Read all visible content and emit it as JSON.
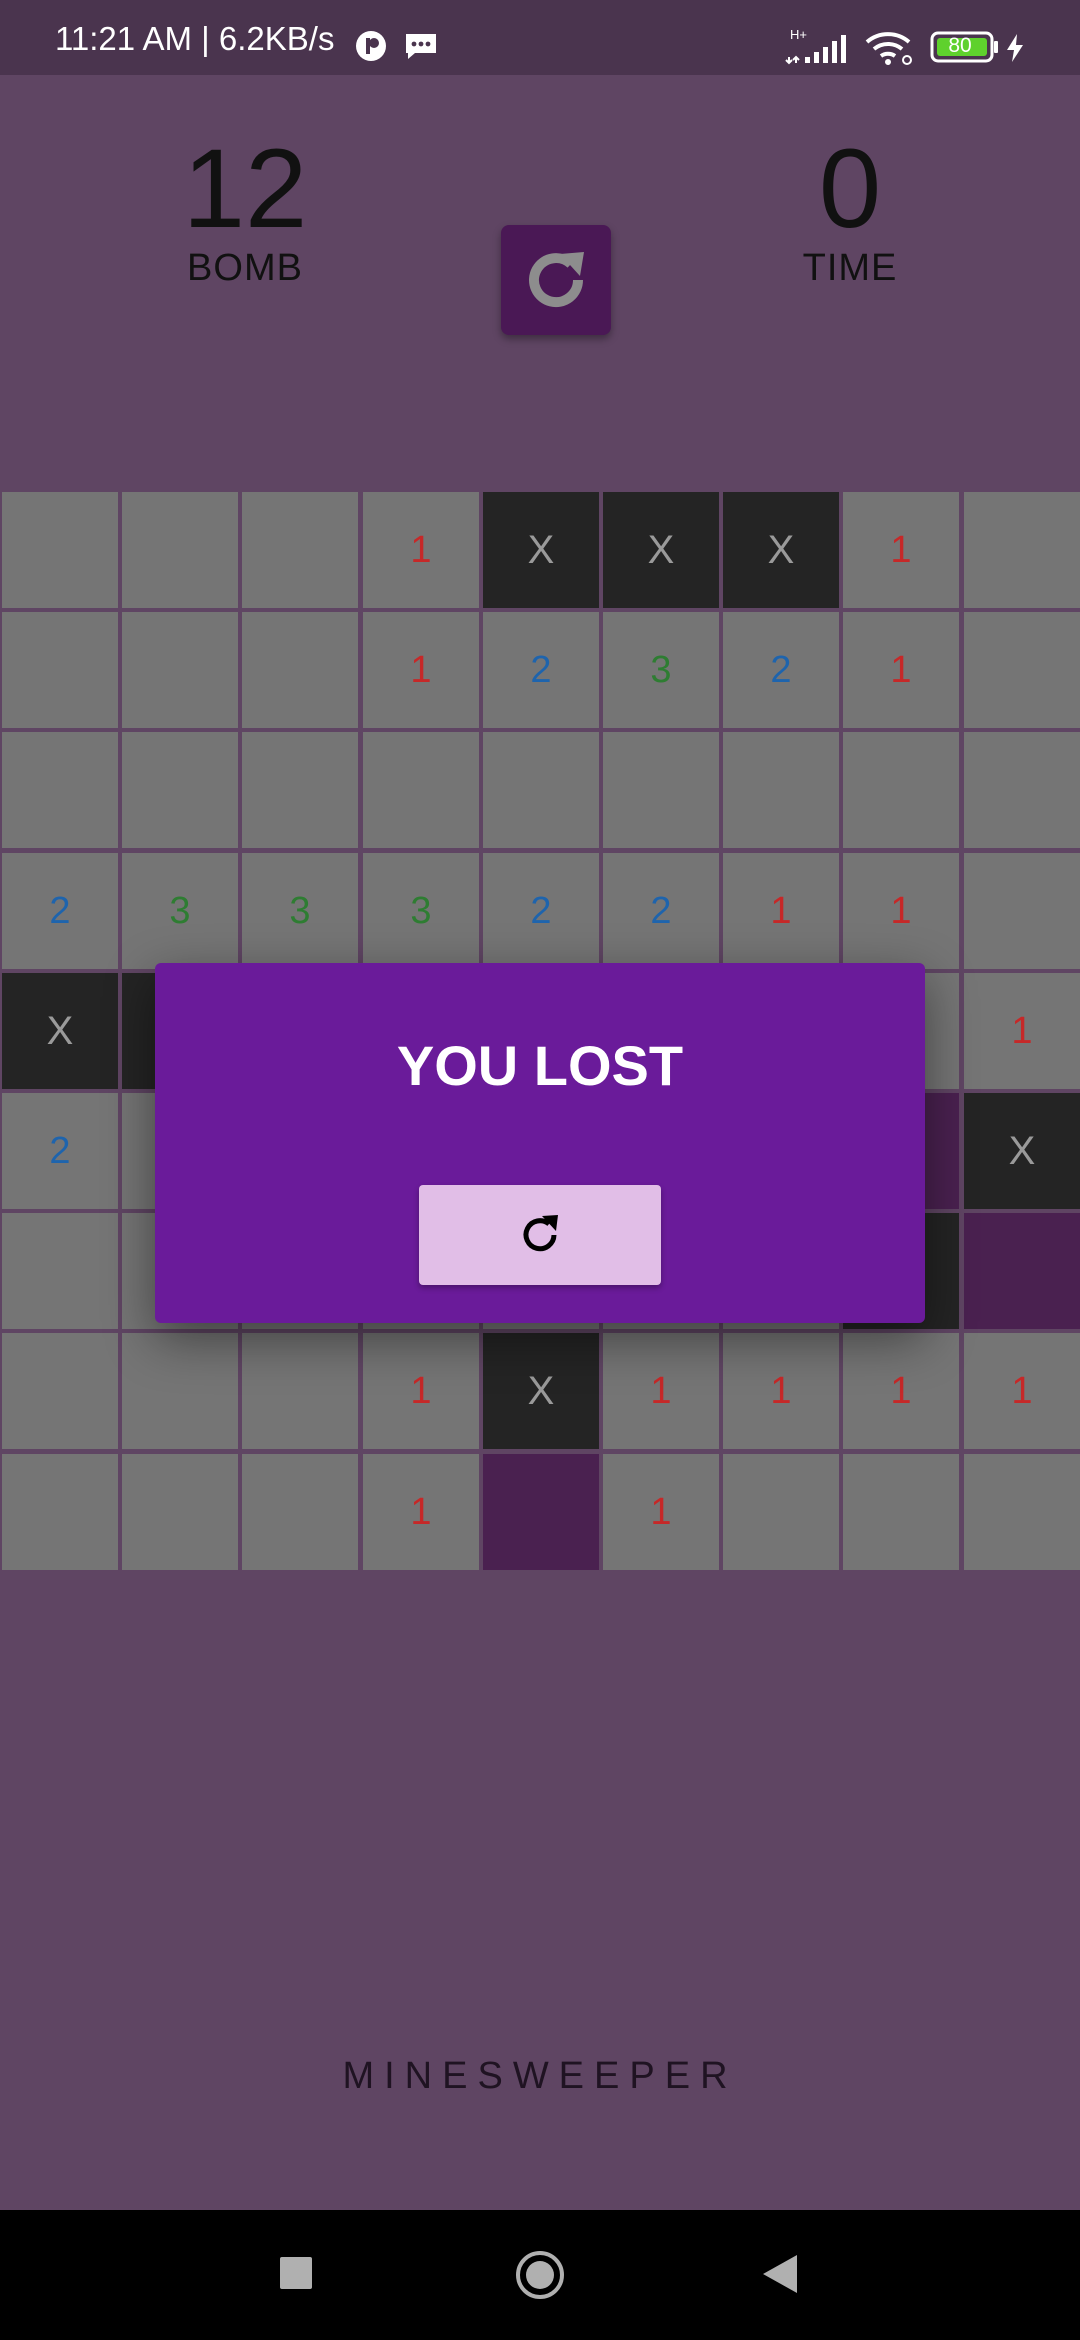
{
  "status_bar": {
    "time_speed": "11:21 AM | 6.2KB/s",
    "network": "H+",
    "battery": "80"
  },
  "game": {
    "bomb_count": "12",
    "bomb_label": "BOMB",
    "time_value": "0",
    "time_label": "TIME",
    "reset_icon": "refresh-icon"
  },
  "board": {
    "rows": 9,
    "cols": 9,
    "cells": [
      [
        "",
        "",
        "",
        "1",
        "X",
        "X",
        "X",
        "1",
        ""
      ],
      [
        "",
        "",
        "",
        "1",
        "2",
        "3",
        "2",
        "1",
        ""
      ],
      [
        "",
        "",
        "",
        "",
        "",
        "",
        "",
        "",
        ""
      ],
      [
        "2",
        "3",
        "3",
        "3",
        "2",
        "2",
        "1",
        "1",
        ""
      ],
      [
        "X",
        "X",
        "",
        "",
        "",
        "",
        "",
        "",
        "1"
      ],
      [
        "2",
        "",
        "",
        "",
        "",
        "",
        "",
        "F",
        "X"
      ],
      [
        "",
        "",
        "",
        "",
        "",
        "",
        "",
        "X",
        "F"
      ],
      [
        "",
        "",
        "",
        "1",
        "X",
        "1",
        "1",
        "1",
        "1"
      ],
      [
        "",
        "",
        "",
        "1",
        "F",
        "1",
        "",
        "",
        ""
      ]
    ],
    "colors": {
      "cell": "#757575",
      "bomb": "#242424",
      "flag": "#4a2150",
      "one": "#c62828",
      "two": "#1e64ad",
      "three": "#2e7d32"
    }
  },
  "dialog": {
    "title": "YOU LOST",
    "button_icon": "refresh-icon"
  },
  "footer": {
    "app_name": "MINESWEEPER"
  },
  "nav_bar": {
    "icons": [
      "recents-square-icon",
      "home-circle-icon",
      "back-triangle-icon"
    ]
  }
}
